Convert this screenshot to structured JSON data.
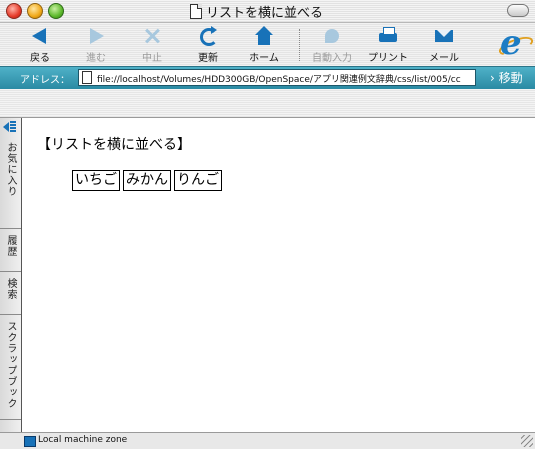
{
  "window": {
    "title": "リストを横に並べる"
  },
  "toolbar": {
    "back": "戻る",
    "forward": "進む",
    "stop": "中止",
    "refresh": "更新",
    "home": "ホーム",
    "autofill": "自動入力",
    "print": "プリント",
    "mail": "メール"
  },
  "address": {
    "label": "アドレス：",
    "url": "file://localhost/Volumes/HDD300GB/OpenSpace/アプリ関連例文辞典/css/list/005/cc",
    "go": "› 移動"
  },
  "sidebar": {
    "tabs": [
      "お気に入り",
      "履歴",
      "検索",
      "スクラップブック"
    ]
  },
  "page": {
    "heading": "【リストを横に並べる】",
    "items": [
      "いちご",
      "みかん",
      "りんご"
    ]
  },
  "status": {
    "zone": "Local machine zone"
  },
  "colors": {
    "accent": "#1872b8",
    "address_bar": "#3a9db6"
  }
}
